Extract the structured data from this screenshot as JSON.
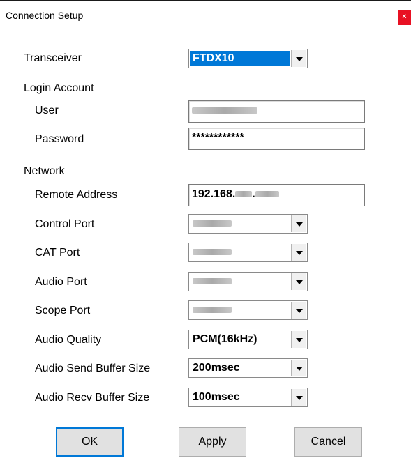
{
  "window": {
    "title": "Connection Setup",
    "close_label": "×"
  },
  "labels": {
    "transceiver": "Transceiver",
    "login_account": "Login Account",
    "user": "User",
    "password": "Password",
    "network": "Network",
    "remote_address": "Remote Address",
    "control_port": "Control Port",
    "cat_port": "CAT Port",
    "audio_port": "Audio Port",
    "scope_port": "Scope Port",
    "audio_quality": "Audio Quality",
    "audio_send_buffer": "Audio Send Buffer Size",
    "audio_recv_buffer": "Audio Recv Buffer Size"
  },
  "values": {
    "transceiver": "FTDX10",
    "password": "************",
    "remote_address_prefix": "192.168.",
    "audio_quality": "PCM(16kHz)",
    "audio_send_buffer": "200msec",
    "audio_recv_buffer": "100msec"
  },
  "buttons": {
    "ok": "OK",
    "apply": "Apply",
    "cancel": "Cancel"
  }
}
